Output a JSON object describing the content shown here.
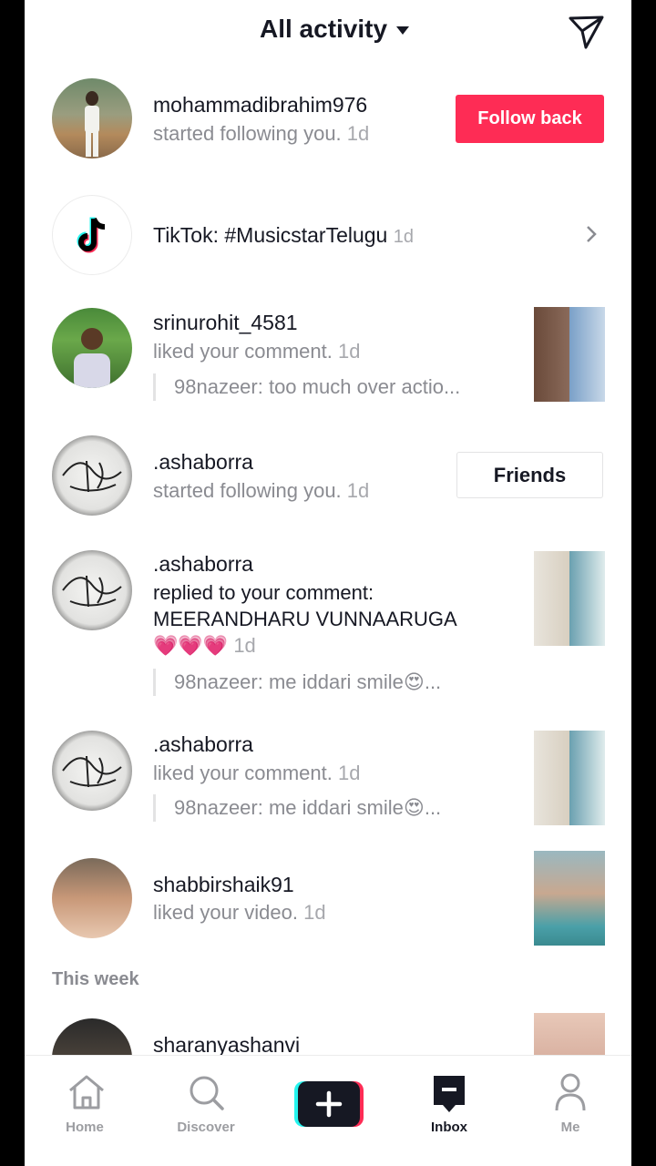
{
  "header": {
    "title": "All activity"
  },
  "notifications": [
    {
      "username": "mohammadibrahim976",
      "action": "started following you.",
      "time": "1d",
      "button": "Follow back"
    },
    {
      "system_text": "TikTok: #MusicstarTelugu",
      "time": "1d"
    },
    {
      "username": "srinurohit_4581",
      "action": "liked your comment.",
      "time": "1d",
      "quote": "98nazeer: too much over actio..."
    },
    {
      "username": ".ashaborra",
      "action": "started following you.",
      "time": "1d",
      "button": "Friends"
    },
    {
      "username": ".ashaborra",
      "action": "replied to your comment:",
      "reply": "MEERANDHARU VUNNAARUGA",
      "emoji": "💗💗💗",
      "time": "1d",
      "quote": "98nazeer: me iddari smile😍..."
    },
    {
      "username": ".ashaborra",
      "action": "liked your comment.",
      "time": "1d",
      "quote": "98nazeer: me iddari smile😍..."
    },
    {
      "username": "shabbirshaik91",
      "action": "liked your video.",
      "time": "1d"
    }
  ],
  "section_this_week": "This week",
  "partial_row": {
    "username": "sharanyashanvi"
  },
  "tabbar": {
    "home": "Home",
    "discover": "Discover",
    "inbox": "Inbox",
    "me": "Me"
  },
  "colors": {
    "accent": "#fe2c55",
    "text": "#161823",
    "muted": "#8a8b91",
    "cyan": "#25f4ee"
  },
  "icons": [
    "dropdown-caret-icon",
    "send-icon",
    "tiktok-logo-icon",
    "chevron-right-icon",
    "home-icon",
    "discover-icon",
    "plus-icon",
    "inbox-icon",
    "profile-icon"
  ]
}
